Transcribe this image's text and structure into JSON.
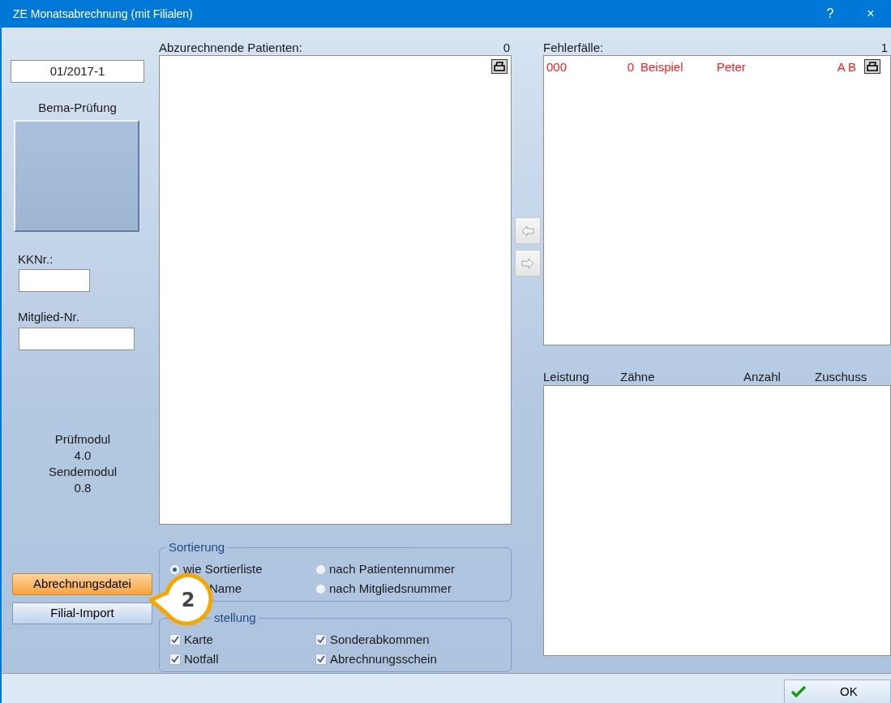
{
  "window": {
    "title": "ZE Monatsabrechnung (mit Filialen)",
    "buttons": [
      "?",
      "×"
    ]
  },
  "left": {
    "period": "01/2017-1",
    "bema_label": "Bema-Prüfung",
    "kk_label": "KKNr.:",
    "member_label": "Mitglied-Nr.",
    "modules": [
      "Prüfmodul",
      "4.0",
      "Sendemodul",
      "0.8"
    ],
    "buttons": [
      {
        "label": "Abrechnungsdatei",
        "kind": "primary"
      },
      {
        "label": "Filial-Import",
        "kind": "normal"
      }
    ]
  },
  "patients": {
    "label": "Abzurechnende Patienten:",
    "count": "0"
  },
  "sorting": {
    "legend": "Sortierung",
    "options": [
      {
        "label": "wie Sortierliste",
        "selected": true
      },
      {
        "label": "nach Patientennummer",
        "selected": false
      },
      {
        "label": "Name"
      },
      {
        "label": "nach Mitgliedsnummer",
        "selected": false
      }
    ]
  },
  "presets": {
    "legend": "stellung",
    "options": [
      {
        "label": "Karte",
        "checked": true
      },
      {
        "label": "Sonderabkommen",
        "checked": true
      },
      {
        "label": "Notfall",
        "checked": true
      },
      {
        "label": "Abrechnungsschein",
        "checked": true
      }
    ]
  },
  "errors": {
    "label": "Fehlerfälle:",
    "count": "1",
    "rows": [
      {
        "cells": [
          "000",
          "0",
          "Beispiel",
          "Peter",
          "A B"
        ]
      }
    ]
  },
  "services": {
    "columns": [
      "Leistung",
      "Zähne",
      "Anzahl",
      "Zuschuss"
    ]
  },
  "ok_button": "OK",
  "callout": "2"
}
